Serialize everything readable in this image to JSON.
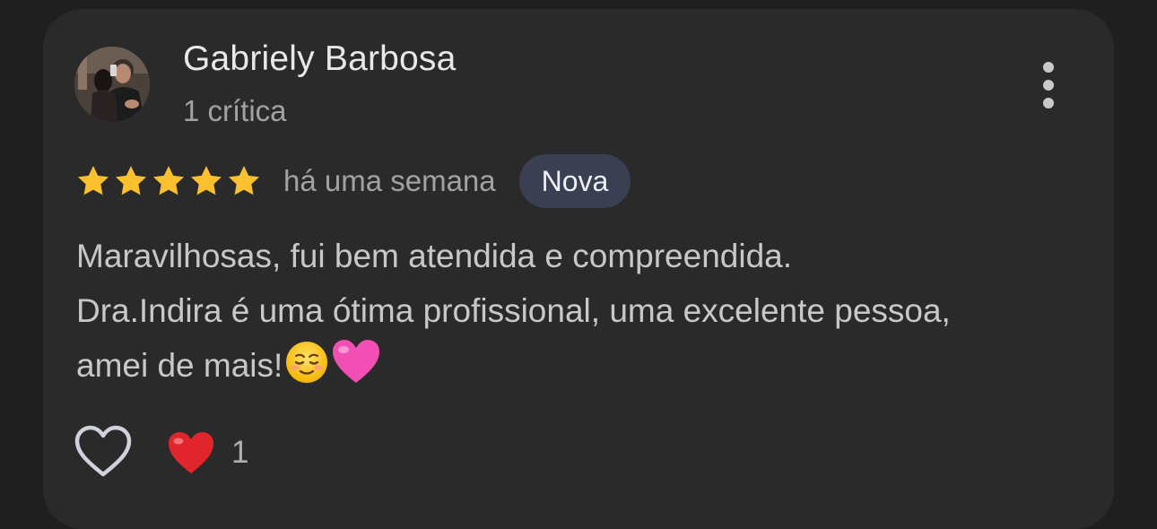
{
  "review": {
    "author": {
      "name": "Gabriely Barbosa",
      "review_count": "1 crítica",
      "avatar": "profile-photo"
    },
    "rating": 5,
    "max_rating": 5,
    "time_ago": "há uma semana",
    "badge": "Nova",
    "text_lines": [
      "Maravilhosas, fui bem atendida e compreendida.",
      "Dra.Indira é uma ótima profissional, uma excelente pessoa,",
      "amei de mais!"
    ],
    "text_emojis": [
      "smiling-face-emoji",
      "pink-heart-emoji"
    ],
    "reactions": {
      "emoji": "red-heart-emoji",
      "count": "1"
    }
  },
  "icons": {
    "more": "more-vert-icon",
    "like": "heart-outline-icon",
    "star": "star-icon"
  },
  "colors": {
    "background": "#1f1f1f",
    "card": "#2a2a2a",
    "star": "#fbc02d",
    "badge_bg": "#3a3f52",
    "heart": "#e0262c",
    "pink_heart": "#f24fb4"
  }
}
